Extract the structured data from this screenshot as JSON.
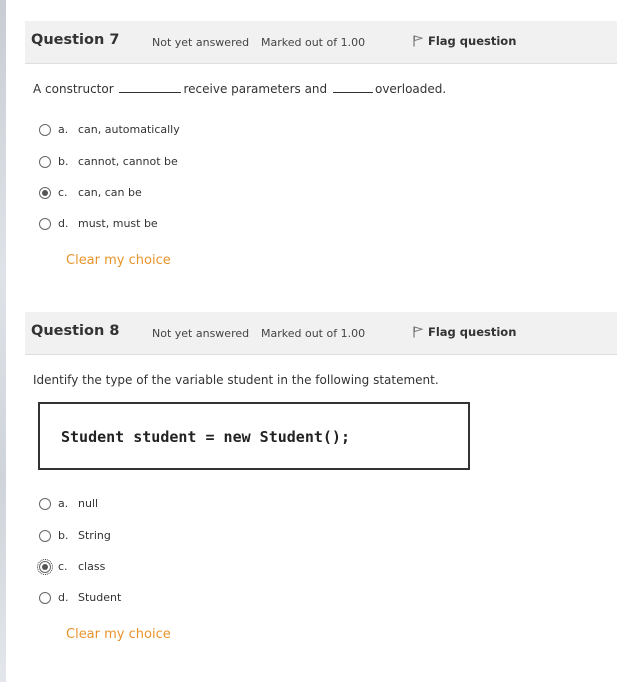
{
  "questions": [
    {
      "number_label": "Question 7",
      "state": "Not yet answered",
      "marks": "Marked out of 1.00",
      "flag_label": "Flag question",
      "text": {
        "part1": "A constructor",
        "part2": "receive parameters and",
        "part3": "overloaded."
      },
      "options": [
        {
          "letter": "a.",
          "text": "can, automatically",
          "selected": false
        },
        {
          "letter": "b.",
          "text": "cannot, cannot be",
          "selected": false
        },
        {
          "letter": "c.",
          "text": "can, can be",
          "selected": true
        },
        {
          "letter": "d.",
          "text": "must, must be",
          "selected": false
        }
      ],
      "clear_label": "Clear my choice"
    },
    {
      "number_label": "Question 8",
      "state": "Not yet answered",
      "marks": "Marked out of 1.00",
      "flag_label": "Flag question",
      "text": "Identify the type of the variable student in the following statement.",
      "code": "Student student = new Student();",
      "options": [
        {
          "letter": "a.",
          "text": "null",
          "selected": false
        },
        {
          "letter": "b.",
          "text": "String",
          "selected": false
        },
        {
          "letter": "c.",
          "text": "class",
          "selected": true
        },
        {
          "letter": "d.",
          "text": "Student",
          "selected": false
        }
      ],
      "clear_label": "Clear my choice"
    }
  ],
  "colors": {
    "header_bg": "#f1f1f1",
    "link": "#e8932a",
    "text": "#333333"
  },
  "icons": [
    "flag-icon",
    "radio-icon"
  ]
}
